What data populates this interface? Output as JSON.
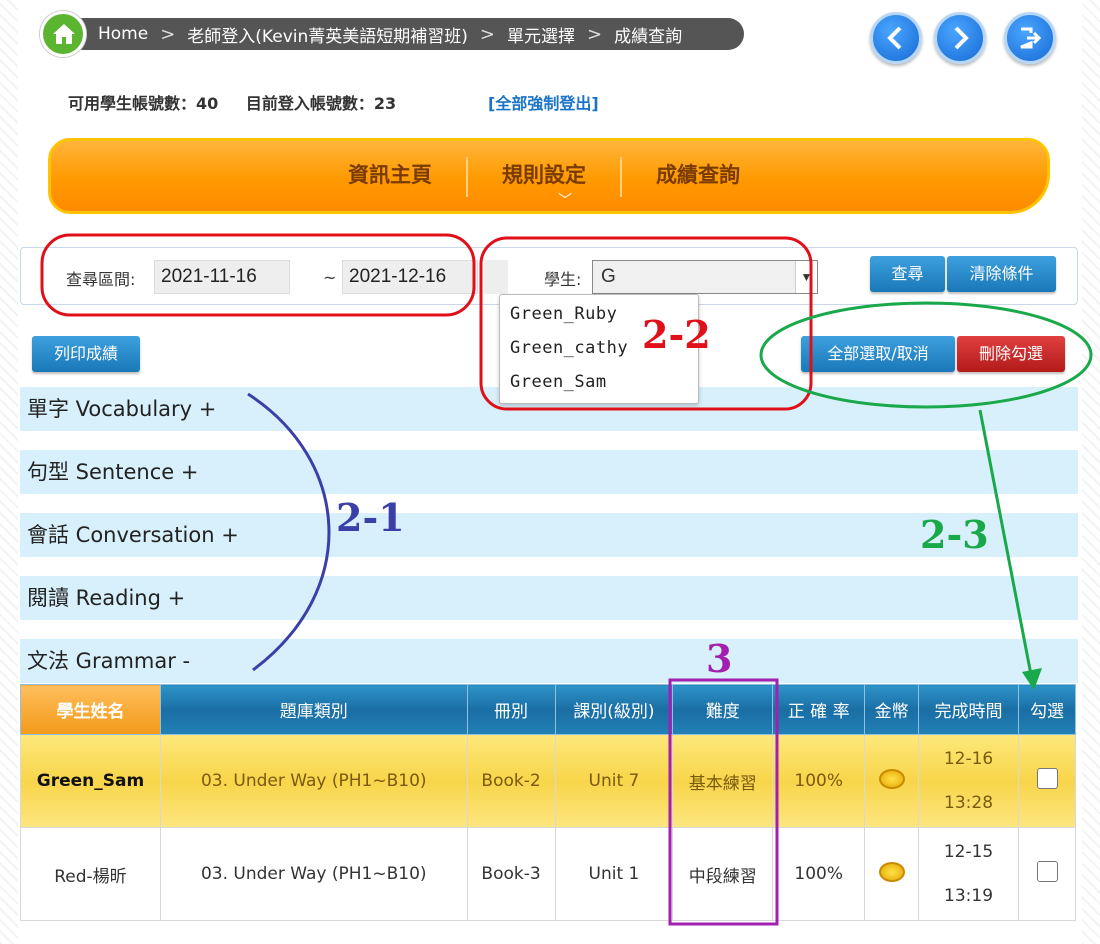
{
  "breadcrumb": {
    "items": [
      "Home",
      "老師登入(Kevin菁英美語短期補習班)",
      "單元選擇",
      "成績查詢"
    ],
    "separator": ">"
  },
  "stats": {
    "available_label": "可用學生帳號數：",
    "available_value": "40",
    "logged_in_label": "目前登入帳號數：",
    "logged_in_value": "23",
    "force_logout": "[全部強制登出]"
  },
  "menu": {
    "items": [
      "資訊主頁",
      "規則設定",
      "成績查詢"
    ]
  },
  "search": {
    "range_label": "查尋區間:",
    "start_date": "2021-11-16",
    "tilde": "~",
    "end_date": "2021-12-16",
    "student_label": "學生:",
    "student_value": "G",
    "query_button": "查尋",
    "clear_button": "清除條件"
  },
  "dropdown": {
    "options": [
      "Green_Ruby",
      "Green_cathy",
      "Green_Sam"
    ]
  },
  "actions": {
    "print": "列印成績",
    "select_all": "全部選取/取消",
    "delete_checked": "刪除勾選"
  },
  "accordion": [
    "單字 Vocabulary +",
    "句型 Sentence +",
    "會話 Conversation +",
    "閱讀 Reading +",
    "文法 Grammar -"
  ],
  "table": {
    "headers": [
      "學生姓名",
      "題庫類別",
      "冊別",
      "課別(級別)",
      "難度",
      "正 確 率",
      "金幣",
      "完成時間",
      "勾選"
    ],
    "rows": [
      {
        "name": "Green_Sam",
        "category": "03. Under Way (PH1~B10)",
        "book": "Book-2",
        "unit": "Unit 7",
        "level": "基本練習",
        "accuracy": "100%",
        "date": "12-16",
        "time": "13:28"
      },
      {
        "name": "Red-楊昕",
        "category": "03. Under Way (PH1~B10)",
        "book": "Book-3",
        "unit": "Unit 1",
        "level": "中段練習",
        "accuracy": "100%",
        "date": "12-15",
        "time": "13:19"
      }
    ]
  },
  "annotations": {
    "a21": "2-1",
    "a22": "2-2",
    "a23": "2-3",
    "a3": "3",
    "colors": {
      "red": "#e0101a",
      "blue": "#3b3fa8",
      "green": "#19a84a",
      "purple": "#a21fb0"
    }
  }
}
